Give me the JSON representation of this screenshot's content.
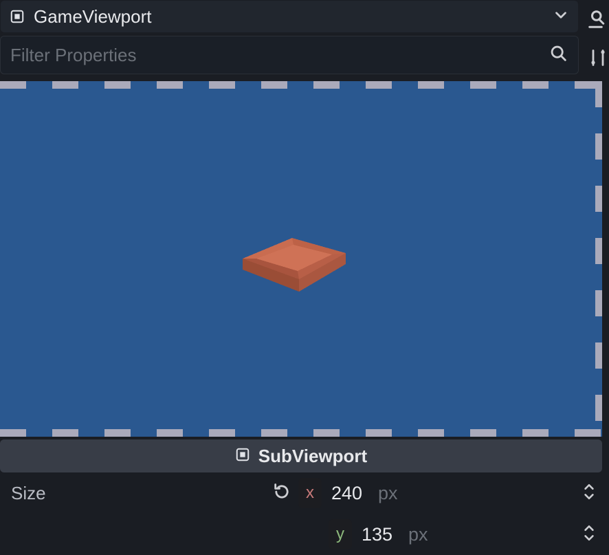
{
  "header": {
    "title": "GameViewport"
  },
  "filter": {
    "placeholder": "Filter Properties"
  },
  "section": {
    "title": "SubViewport"
  },
  "props": {
    "size": {
      "label": "Size",
      "x": {
        "axis": "x",
        "value": "240",
        "unit": "px"
      },
      "y": {
        "axis": "y",
        "value": "135",
        "unit": "px"
      }
    }
  }
}
